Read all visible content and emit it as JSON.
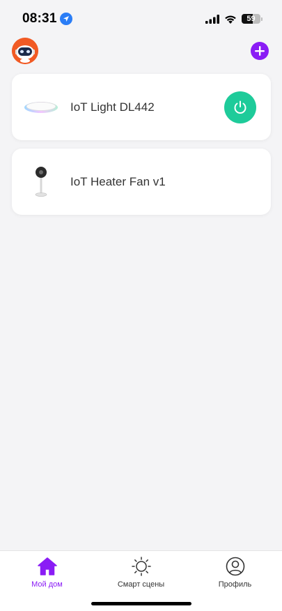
{
  "status_bar": {
    "time": "08:31",
    "battery_level": "59",
    "battery_fraction": 0.59
  },
  "header": {
    "avatar_icon": "robot-avatar-icon",
    "add_icon": "plus-icon"
  },
  "devices": [
    {
      "name": "IoT Light DL442",
      "icon": "ceiling-light-icon",
      "has_power_button": true,
      "power_icon": "power-icon"
    },
    {
      "name": "IoT Heater Fan v1",
      "icon": "heater-fan-icon",
      "has_power_button": false
    }
  ],
  "tabs": [
    {
      "label": "Мой дом",
      "icon": "home-icon",
      "active": true
    },
    {
      "label": "Смарт сцены",
      "icon": "sun-icon",
      "active": false
    },
    {
      "label": "Профиль",
      "icon": "profile-icon",
      "active": false
    }
  ],
  "colors": {
    "accent": "#8a1cf5",
    "power_on": "#1ecb9a",
    "avatar": "#f15a24",
    "background": "#f4f4f6"
  }
}
